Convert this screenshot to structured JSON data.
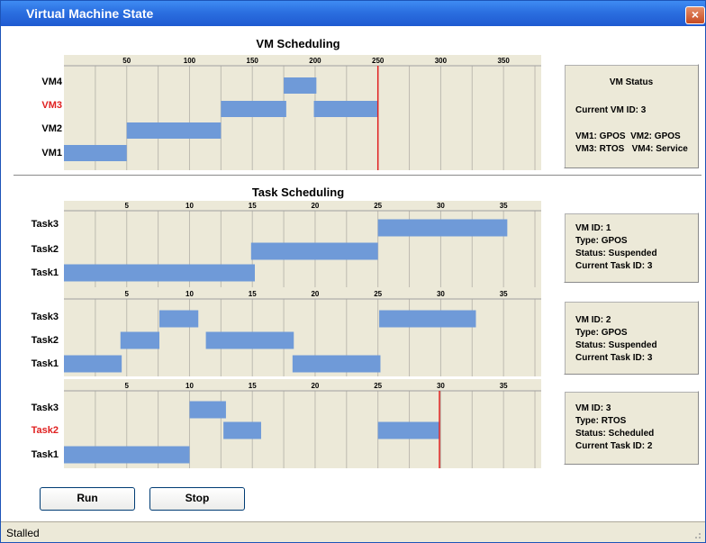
{
  "window": {
    "title": "Virtual Machine State",
    "close_label": "×"
  },
  "vm_section": {
    "title": "VM Scheduling",
    "x_ticks": [
      "50",
      "100",
      "150",
      "200",
      "250",
      "300",
      "350"
    ],
    "rows": [
      {
        "label": "VM4",
        "highlight": false
      },
      {
        "label": "VM3",
        "highlight": true
      },
      {
        "label": "VM2",
        "highlight": false
      },
      {
        "label": "VM1",
        "highlight": false
      }
    ],
    "status": {
      "title": "VM Status",
      "current": "Current VM ID: 3",
      "line1": "VM1: GPOS  VM2: GPOS",
      "line2": "VM3: RTOS   VM4: Service"
    }
  },
  "task_section": {
    "title": "Task Scheduling",
    "x_ticks": [
      "5",
      "10",
      "15",
      "20",
      "25",
      "30",
      "35"
    ],
    "charts": [
      {
        "rows": [
          {
            "label": "Task3",
            "highlight": false
          },
          {
            "label": "Task2",
            "highlight": false
          },
          {
            "label": "Task1",
            "highlight": false
          }
        ],
        "info": {
          "vm_id": "VM ID: 1",
          "type": "Type: GPOS",
          "status": "Status: Suspended",
          "task": "Current Task ID: 3"
        }
      },
      {
        "rows": [
          {
            "label": "Task3",
            "highlight": false
          },
          {
            "label": "Task2",
            "highlight": false
          },
          {
            "label": "Task1",
            "highlight": false
          }
        ],
        "info": {
          "vm_id": "VM ID: 2",
          "type": "Type: GPOS",
          "status": "Status: Suspended",
          "task": "Current Task ID: 3"
        }
      },
      {
        "rows": [
          {
            "label": "Task3",
            "highlight": false
          },
          {
            "label": "Task2",
            "highlight": true
          },
          {
            "label": "Task1",
            "highlight": false
          }
        ],
        "info": {
          "vm_id": "VM ID: 3",
          "type": "Type: RTOS",
          "status": "Status: Scheduled",
          "task": "Current Task ID: 2"
        }
      }
    ]
  },
  "buttons": {
    "run": "Run",
    "stop": "Stop"
  },
  "statusbar": {
    "text": "Stalled"
  },
  "colors": {
    "bar": "#6f9ad8",
    "highlight": "#e02020",
    "grid": "#bdbab0",
    "panel_bg": "#ece9d8"
  },
  "chart_data": [
    {
      "type": "gantt",
      "title": "VM Scheduling",
      "xlim": [
        0,
        380
      ],
      "categories": [
        "VM1",
        "VM2",
        "VM3",
        "VM4"
      ],
      "bars": [
        {
          "row": "VM1",
          "start": 0,
          "end": 50
        },
        {
          "row": "VM2",
          "start": 50,
          "end": 125
        },
        {
          "row": "VM3",
          "start": 125,
          "end": 177
        },
        {
          "row": "VM4",
          "start": 175,
          "end": 201
        },
        {
          "row": "VM3",
          "start": 199,
          "end": 250
        }
      ],
      "current_time": 250
    },
    {
      "type": "gantt",
      "xlim": [
        0,
        38
      ],
      "categories": [
        "Task1",
        "Task2",
        "Task3"
      ],
      "bars": [
        {
          "row": "Task1",
          "start": 0,
          "end": 15.2
        },
        {
          "row": "Task2",
          "start": 14.9,
          "end": 25
        },
        {
          "row": "Task3",
          "start": 25,
          "end": 35.3
        }
      ]
    },
    {
      "type": "gantt",
      "xlim": [
        0,
        38
      ],
      "categories": [
        "Task1",
        "Task2",
        "Task3"
      ],
      "bars": [
        {
          "row": "Task1",
          "start": 0,
          "end": 4.6
        },
        {
          "row": "Task2",
          "start": 4.5,
          "end": 7.6
        },
        {
          "row": "Task3",
          "start": 7.6,
          "end": 10.7
        },
        {
          "row": "Task2",
          "start": 11.3,
          "end": 18.3
        },
        {
          "row": "Task1",
          "start": 18.2,
          "end": 25.2
        },
        {
          "row": "Task3",
          "start": 25.1,
          "end": 32.8
        }
      ]
    },
    {
      "type": "gantt",
      "xlim": [
        0,
        38
      ],
      "categories": [
        "Task1",
        "Task2",
        "Task3"
      ],
      "bars": [
        {
          "row": "Task1",
          "start": 0,
          "end": 10
        },
        {
          "row": "Task3",
          "start": 10,
          "end": 12.9
        },
        {
          "row": "Task2",
          "start": 12.7,
          "end": 15.7
        },
        {
          "row": "Task2",
          "start": 25,
          "end": 29.9
        }
      ],
      "current_time": 29.9
    }
  ]
}
